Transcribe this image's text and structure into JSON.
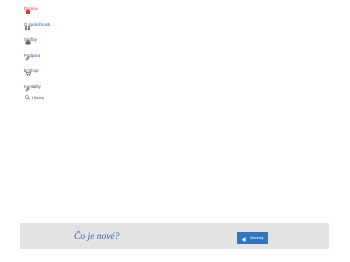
{
  "nav": {
    "items": [
      {
        "label": "Domov",
        "icon": "home-icon",
        "active": true
      },
      {
        "label": "O spoločnosti",
        "icon": "people-icon",
        "active": false
      },
      {
        "label": "Služby",
        "icon": "briefcase-icon",
        "active": false
      },
      {
        "label": "Podpora",
        "icon": "link-icon",
        "active": false
      },
      {
        "label": "E-Shop",
        "icon": "cart-icon",
        "active": false
      },
      {
        "label": "Kontakty",
        "icon": "link-icon",
        "active": false
      }
    ]
  },
  "search": {
    "label": "Hľadaj",
    "icon": "search-icon"
  },
  "promo": {
    "title": "Čo je nové?",
    "button_label": "Novinky",
    "button_icon": "megaphone-icon"
  },
  "colors": {
    "active": "#d63a3a",
    "link": "#1f4e8c",
    "promo_bg": "#e3e3e3",
    "promo_title": "#2f64b4",
    "button_bg": "#2c78c2"
  }
}
